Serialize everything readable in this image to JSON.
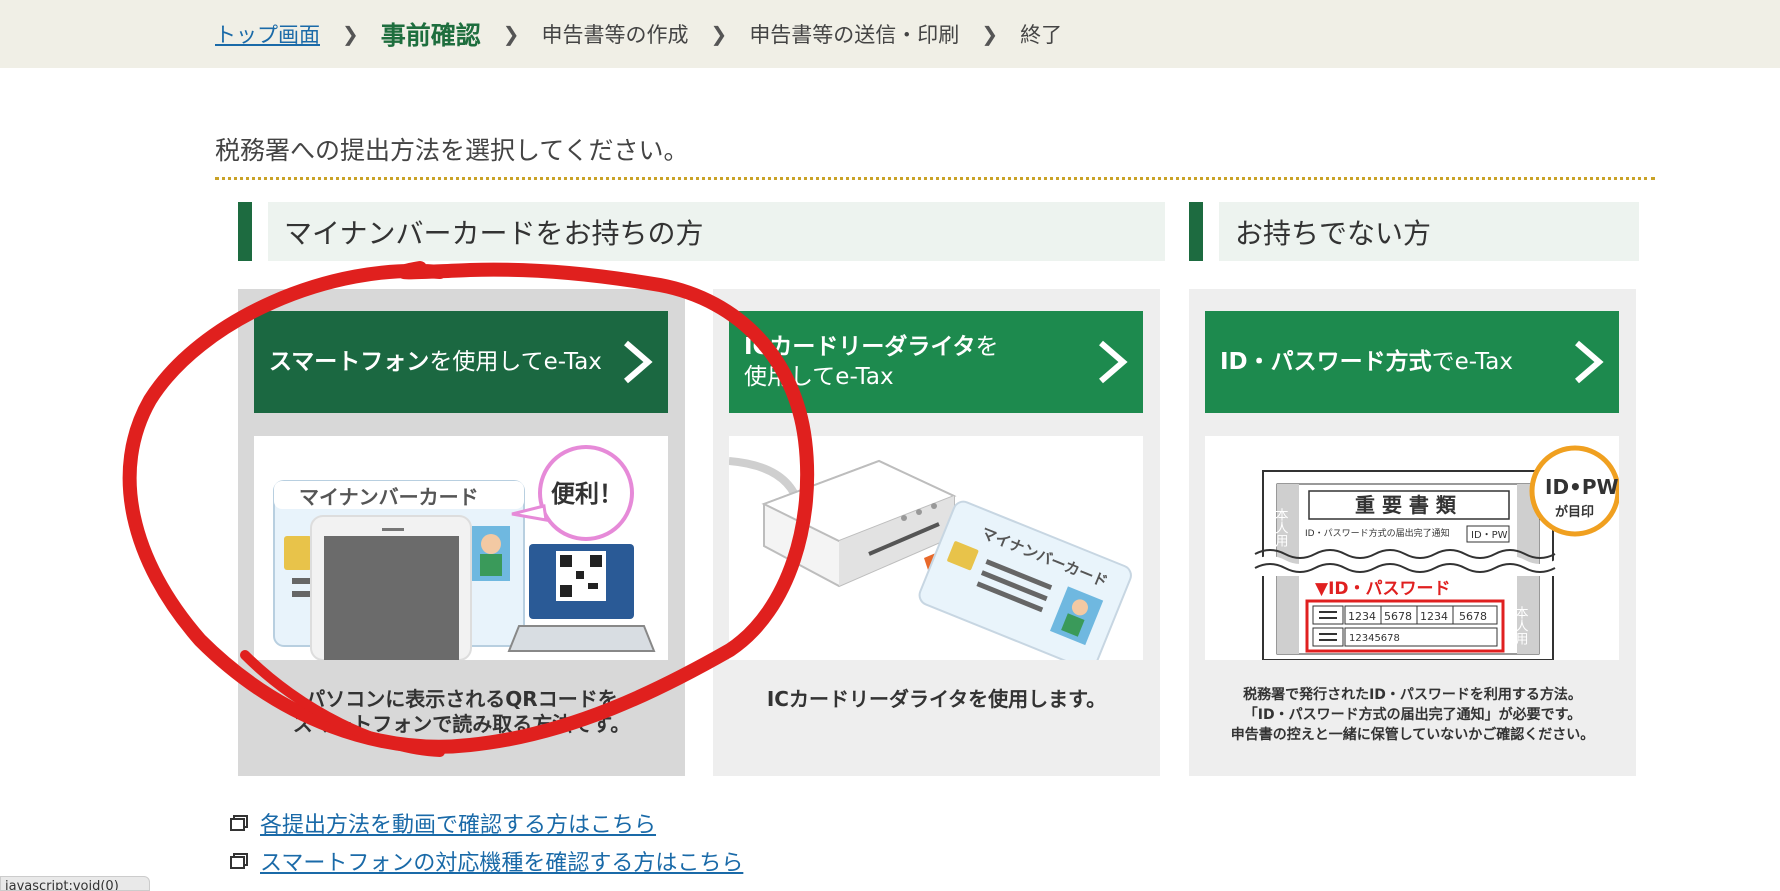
{
  "breadcrumb": {
    "top": "トップ画面",
    "current": "事前確認",
    "step3": "申告書等の作成",
    "step4": "申告書等の送信・印刷",
    "step5": "終了"
  },
  "instruction": "税務署への提出方法を選択してください。",
  "sections": {
    "with_card": "マイナンバーカードをお持ちの方",
    "without_card": "お持ちでない方"
  },
  "cards": [
    {
      "btn_bold": "スマートフォン",
      "btn_normal": "を使用してe-Tax",
      "desc_line1": "パソコンに表示されるQRコードを",
      "desc_line2": "スマートフォンで読み取る方法です。",
      "illus_card_title": "マイナンバーカード",
      "illus_bubble": "便利！"
    },
    {
      "btn_bold": "ICカードリーダライタ",
      "btn_normal1": "を",
      "btn_normal2": "使用してe-Tax",
      "desc_line1": "ICカードリーダライタを使用します。",
      "illus_card_title": "マイナンバーカード"
    },
    {
      "btn_bold": "ID・パスワード方式",
      "btn_normal": "でe-Tax",
      "desc_line1": "税務署で発行されたID・パスワードを利用する方法。",
      "desc_line2": "「ID・パスワード方式の届出完了通知」が必要です。",
      "desc_line3": "申告書の控えと一緒に保管していないかご確認ください。",
      "illus_doc_title": "重 要 書 類",
      "illus_doc_sub": "ID・パスワード方式の届出完了通知",
      "illus_idpw_box": "ID・PW",
      "illus_badge_line1": "ID•PW",
      "illus_badge_line2": "が目印",
      "illus_section": "▼ID・パスワード",
      "illus_cells": [
        "1234",
        "5678",
        "1234",
        "5678"
      ],
      "illus_number": "12345678",
      "illus_side_left": "本人用",
      "illus_side_right": "本人用"
    }
  ],
  "links": {
    "video": "各提出方法を動画で確認する方はこちら",
    "smartphone": "スマートフォンの対応機種を確認する方はこちら"
  },
  "status_bar": "javascript:void(0)",
  "colors": {
    "green_dark": "#1b6841",
    "green": "#1d8a4e",
    "accent_dotted": "#c9a227",
    "annotation_red": "#e0201e"
  }
}
